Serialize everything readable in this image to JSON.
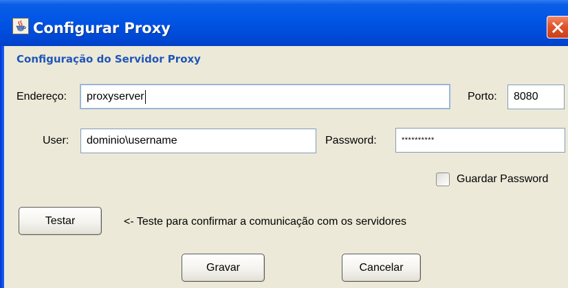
{
  "window": {
    "title": "Configurar Proxy",
    "icon": "java-cup-icon",
    "close_icon": "close-icon"
  },
  "section": {
    "title": "Configuração do Servidor Proxy"
  },
  "form": {
    "address_label": "Endereço:",
    "address_value": "proxyserver",
    "port_label": "Porto:",
    "port_value": "8080",
    "user_label": "User:",
    "user_value": "dominio\\username",
    "password_label": "Password:",
    "password_value": "**********",
    "save_password_label": "Guardar Password",
    "save_password_checked": false
  },
  "test": {
    "button_label": "Testar",
    "hint": "<- Teste para confirmar a comunicação com os servidores"
  },
  "actions": {
    "save_label": "Gravar",
    "cancel_label": "Cancelar"
  },
  "colors": {
    "titlebar": "#0055e5",
    "section_title": "#1f56b8",
    "dialog_bg": "#ece9d8",
    "close_button": "#e2542b"
  }
}
